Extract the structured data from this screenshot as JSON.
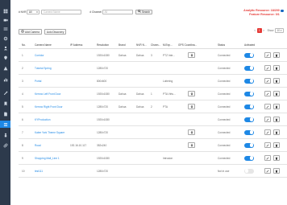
{
  "colors": {
    "sidebar": "#2d3a4c",
    "accent": "#1e88e5",
    "alert": "#e53935"
  },
  "sidebar": {
    "items": [
      {
        "icon": "dashboard-icon"
      },
      {
        "icon": "camera-icon"
      },
      {
        "icon": "grid-icon"
      },
      {
        "icon": "settings-icon"
      },
      {
        "icon": "user-icon"
      },
      {
        "icon": "location-icon"
      },
      {
        "icon": "alert-icon"
      },
      {
        "icon": "chart-icon"
      },
      {
        "icon": "tools-icon"
      },
      {
        "icon": "bookmark-icon"
      },
      {
        "icon": "file-icon"
      },
      {
        "icon": "list-icon"
      },
      {
        "icon": "person-icon"
      },
      {
        "icon": "link-icon"
      }
    ]
  },
  "filters": {
    "num_label": "# NVR",
    "num_value": "All",
    "camera_name_placeholder": "Camera Name",
    "ip_label": "# Channel",
    "ip_placeholder": "All",
    "search_label": "Search"
  },
  "resources": {
    "analytic": "Analytic Resource: 18/200",
    "feature": "Feature Resource: 0/1"
  },
  "toolbar": {
    "add_camera": "Add Camera",
    "auto_discovery": "Auto Discovery"
  },
  "pager": {
    "prev": "<",
    "page": "1",
    "next": ">",
    "show_label": "Show",
    "show_value": "10"
  },
  "table": {
    "headers": {
      "no": "No.",
      "name": "Camera Name",
      "ip": "IP Address",
      "resolution": "Resolution",
      "brand": "Brand",
      "nvr": "NVR N...",
      "channel": "Chann...",
      "mexp": "M.Exp...",
      "gps": "GPS Coordina...",
      "status": "Status",
      "activated": "Activated"
    },
    "rows": [
      {
        "no": "1",
        "name": "Corridor",
        "ip": "",
        "resolution": "1920x1080",
        "brand": "Dahua",
        "nvr": "Dahua",
        "channel": "3",
        "mexp": "PTZ Inte...",
        "gps": true,
        "status": "Connected",
        "active": true
      },
      {
        "no": "2",
        "name": "Tutorial Spring",
        "ip": "",
        "resolution": "1280x720",
        "brand": "",
        "nvr": "",
        "channel": "",
        "mexp": "",
        "gps": false,
        "status": "Connected",
        "active": true
      },
      {
        "no": "3",
        "name": "Portal",
        "ip": "",
        "resolution": "800x600",
        "brand": "",
        "nvr": "",
        "channel": "",
        "mexp": "Loitering",
        "gps": false,
        "status": "Connected",
        "active": true
      },
      {
        "no": "4",
        "name": "Kerrow Left Front Door",
        "ip": "",
        "resolution": "1920x1080",
        "brand": "Dahua",
        "nvr": "Dahua",
        "channel": "1",
        "mexp": "PTA Virtu...",
        "gps": true,
        "status": "Connected",
        "active": true
      },
      {
        "no": "5",
        "name": "Kerrow Right Front Door",
        "ip": "",
        "resolution": "1280x720",
        "brand": "Dahua",
        "nvr": "Dahua",
        "channel": "2",
        "mexp": "PTA",
        "gps": true,
        "status": "Connected",
        "active": true
      },
      {
        "no": "6",
        "name": "KYProduction",
        "ip": "",
        "resolution": "1920x1080",
        "brand": "",
        "nvr": "",
        "channel": "",
        "mexp": "",
        "gps": false,
        "status": "Connected",
        "active": true
      },
      {
        "no": "7",
        "name": "Kalee York Theme Square",
        "ip": "",
        "resolution": "1280x720",
        "brand": "",
        "nvr": "",
        "channel": "",
        "mexp": "",
        "gps": true,
        "status": "Connected",
        "active": true
      },
      {
        "no": "8",
        "name": "Road",
        "ip": "192.16.10.117",
        "resolution": "352x240",
        "brand": "",
        "nvr": "",
        "channel": "",
        "mexp": "",
        "gps": true,
        "status": "Connected",
        "active": true
      },
      {
        "no": "9",
        "name": "Shopping Mall_Line 1",
        "ip": "",
        "resolution": "1920x1080",
        "brand": "",
        "nvr": "",
        "channel": "",
        "mexp": "Intrusion",
        "gps": false,
        "status": "Connected",
        "active": true
      },
      {
        "no": "10",
        "name": "test111",
        "ip": "",
        "resolution": "1280x720",
        "brand": "",
        "nvr": "",
        "channel": "",
        "mexp": "",
        "gps": false,
        "status": "Not in use",
        "active": false
      }
    ]
  }
}
